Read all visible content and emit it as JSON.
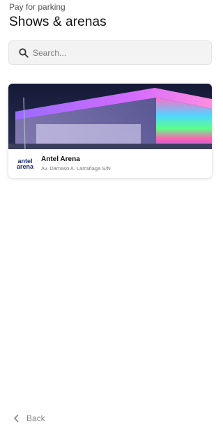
{
  "header": {
    "kicker": "Pay for parking",
    "title": "Shows & arenas"
  },
  "search": {
    "icon": "search-icon",
    "placeholder": "Search..."
  },
  "venues": [
    {
      "name": "Antel Arena",
      "address": "Av. Damaso A. Larrañaga S/N",
      "logo_line1": "antel",
      "logo_line2": "arena"
    }
  ],
  "footer": {
    "back_label": "Back",
    "back_icon": "chevron-left-icon"
  },
  "colors": {
    "logo": "#1c2d6b",
    "sky": "#1a1d3a",
    "arena_glow": "#b35cff"
  }
}
